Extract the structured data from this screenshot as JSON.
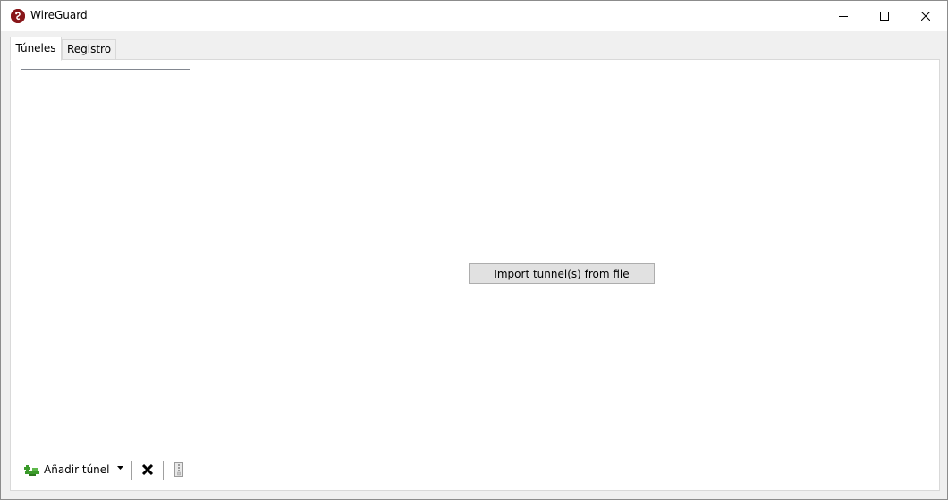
{
  "window": {
    "title": "WireGuard",
    "icon": "wireguard-logo"
  },
  "caption_buttons": {
    "minimize_icon": "minimize-icon",
    "maximize_icon": "maximize-icon",
    "close_icon": "close-icon"
  },
  "tabs": [
    {
      "label": "Túneles",
      "active": true
    },
    {
      "label": "Registro",
      "active": false
    }
  ],
  "tunnels_list": [],
  "toolbar": {
    "add_tunnel_label": "Añadir túnel",
    "add_tunnel_icon": "add-tunnel-icon",
    "dropdown_icon": "chevron-down-icon",
    "delete_icon": "delete-icon",
    "export_icon": "export-zip-icon"
  },
  "main": {
    "import_button_label": "Import tunnel(s) from file"
  },
  "colors": {
    "brand": "#88171a",
    "add_icon_green": "#3b9a2a"
  }
}
